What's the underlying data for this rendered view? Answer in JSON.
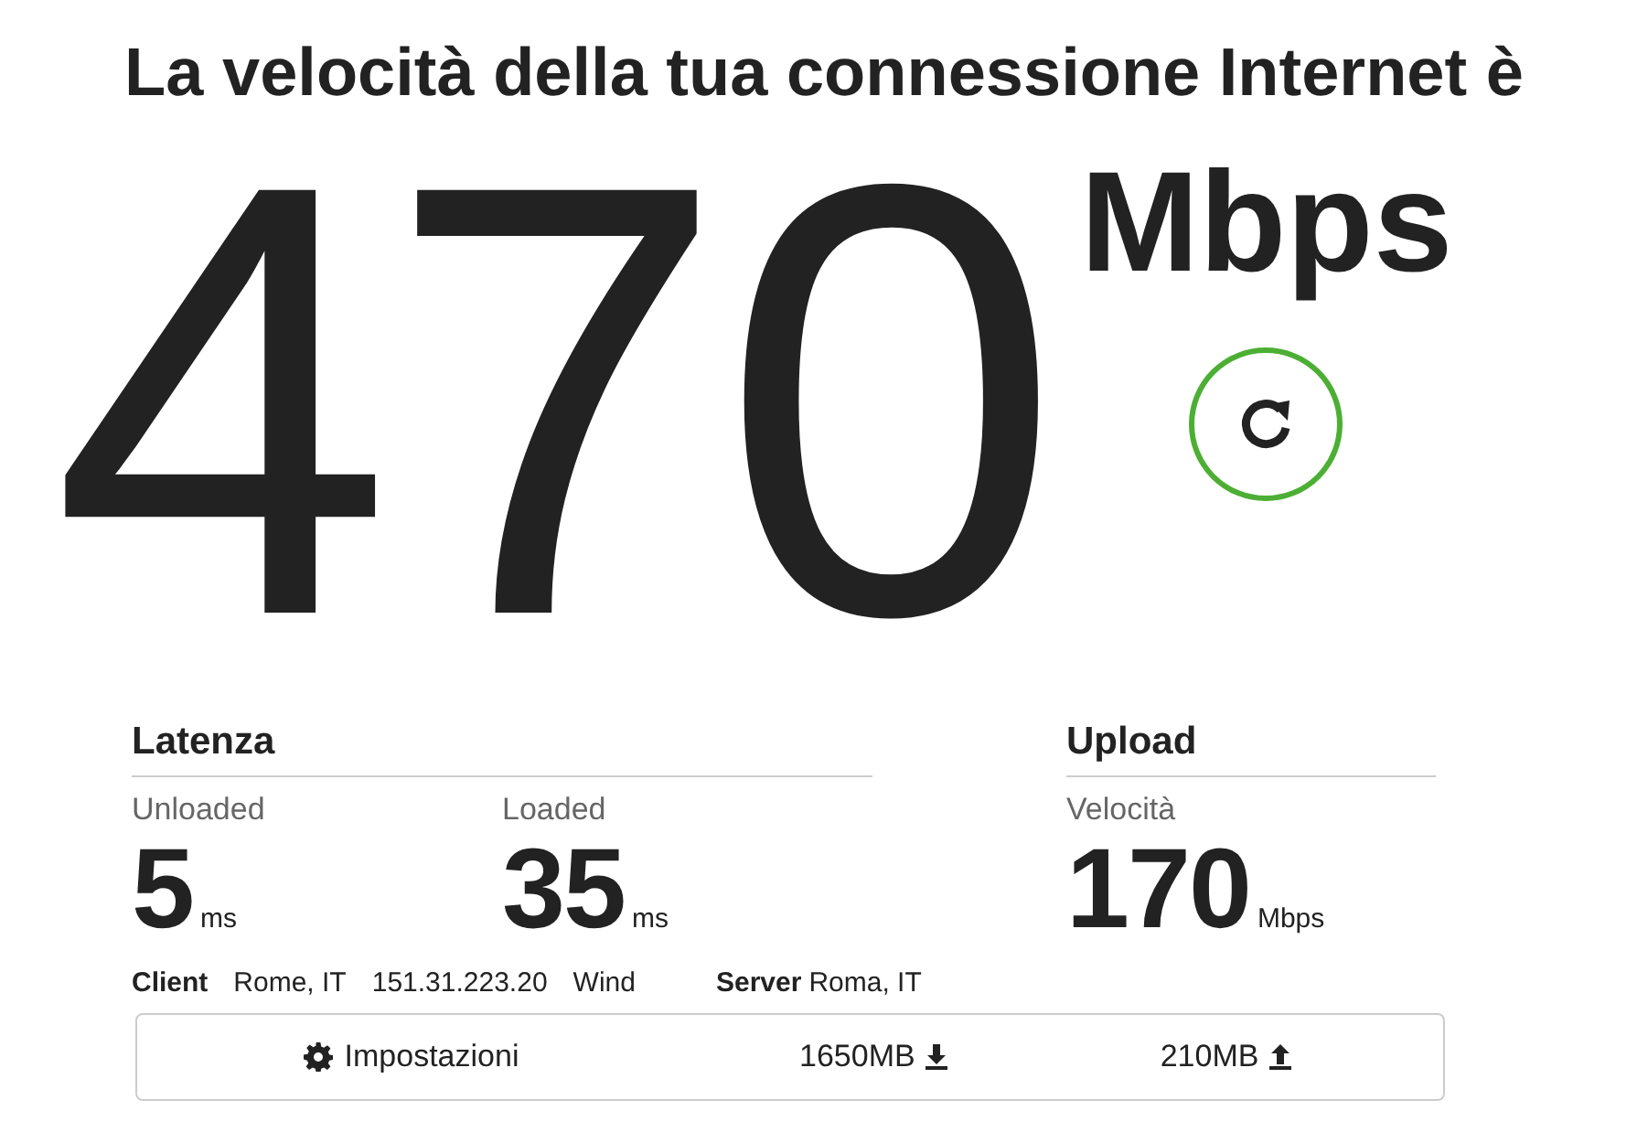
{
  "title": "La velocità della tua connessione Internet è",
  "speed": {
    "value": "470",
    "unit": "Mbps"
  },
  "latency": {
    "heading": "Latenza",
    "metrics": [
      {
        "label": "Unloaded",
        "value": "5",
        "unit": "ms"
      },
      {
        "label": "Loaded",
        "value": "35",
        "unit": "ms"
      }
    ]
  },
  "upload": {
    "heading": "Upload",
    "metrics": [
      {
        "label": "Velocità",
        "value": "170",
        "unit": "Mbps"
      }
    ]
  },
  "client": {
    "label": "Client",
    "location": "Rome, IT",
    "ip": "151.31.223.20",
    "isp": "Wind"
  },
  "server": {
    "label": "Server",
    "location": "Roma, IT"
  },
  "footer": {
    "settings": "Impostazioni",
    "downloaded": "1650MB",
    "uploaded": "210MB"
  }
}
